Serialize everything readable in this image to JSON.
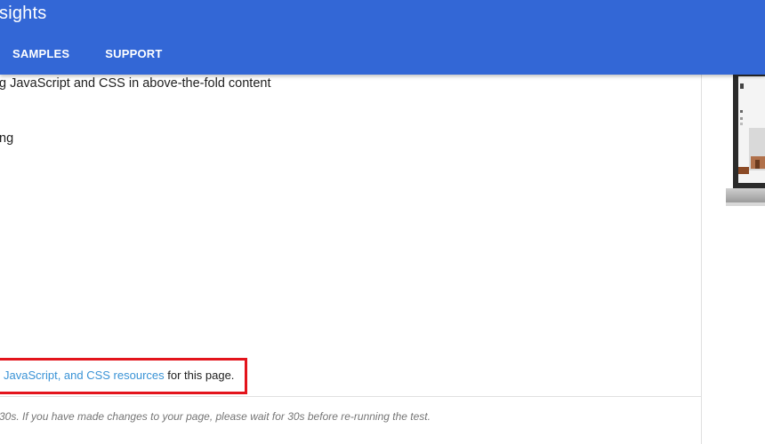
{
  "header": {
    "title": "sights",
    "nav": [
      "SAMPLES",
      "SUPPORT"
    ]
  },
  "main": {
    "line1": "g JavaScript and CSS in above-the-fold content",
    "line2": "ng",
    "resources": {
      "link_text": "JavaScript, and CSS resources",
      "suffix_text": " for this page."
    },
    "note": "30s. If you have made changes to your page, please wait for 30s before re-running the test."
  },
  "colors": {
    "header_bg": "#3367d6",
    "link": "#3a93d6",
    "highlight_border": "#e3141c"
  }
}
